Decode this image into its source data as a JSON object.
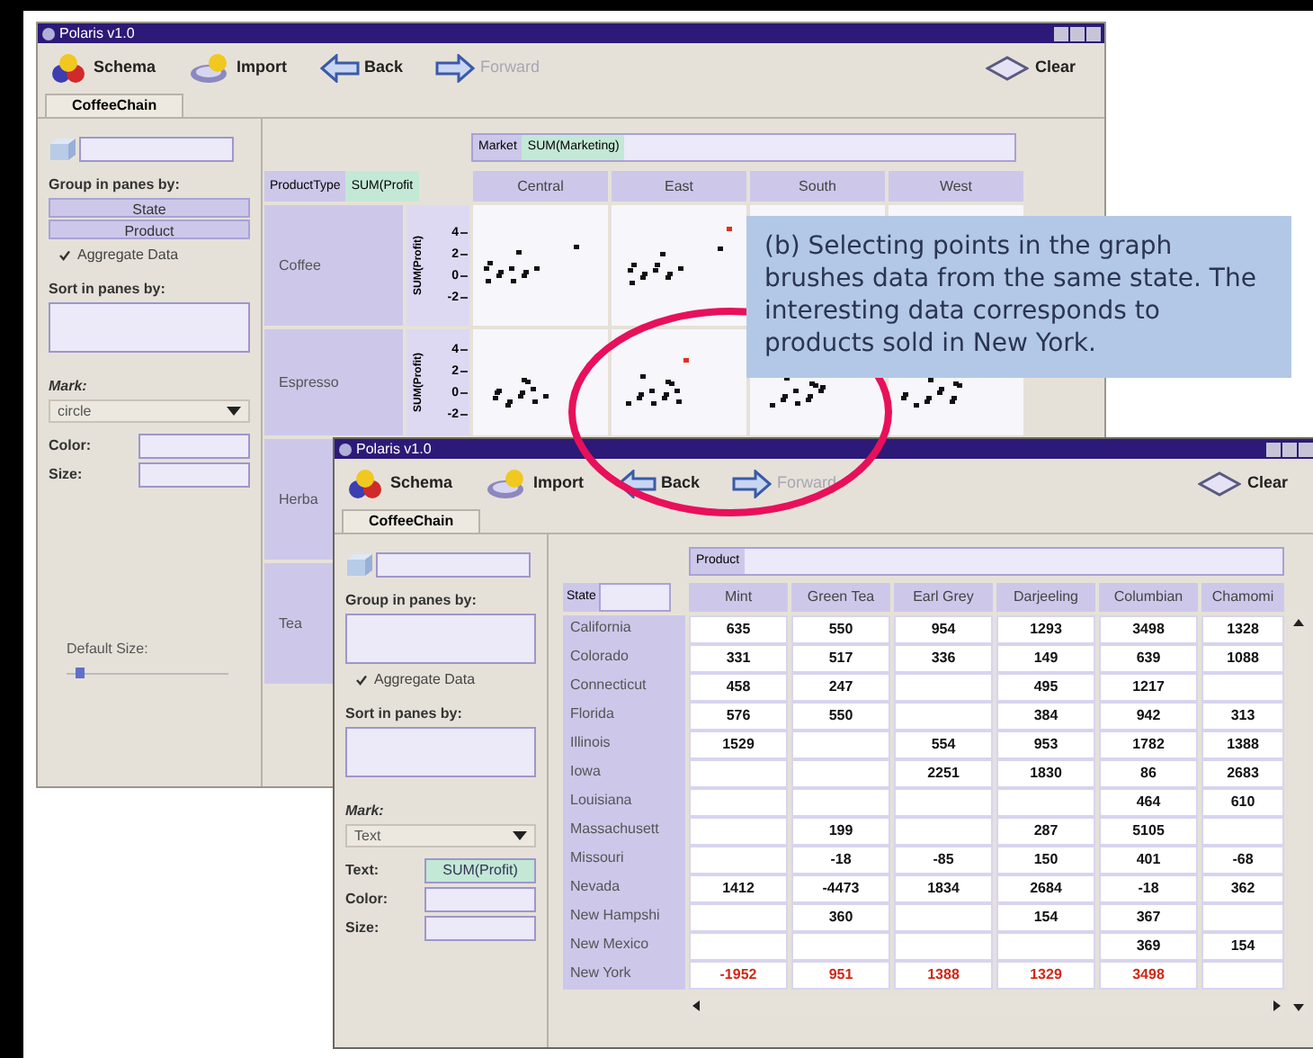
{
  "back_window": {
    "title": "Polaris v1.0",
    "toolbar": [
      {
        "kind": "schema",
        "label": "Schema",
        "disabled": false
      },
      {
        "kind": "import",
        "label": "Import",
        "disabled": false
      },
      {
        "kind": "back",
        "label": "Back",
        "disabled": false
      },
      {
        "kind": "forward",
        "label": "Forward",
        "disabled": true
      },
      {
        "kind": "clear",
        "label": "Clear",
        "disabled": false
      }
    ],
    "tabs": [
      {
        "label": "CoffeeChain",
        "selected": true
      }
    ],
    "left_panel": {
      "group_label": "Group in panes by:",
      "group_items": [
        "State",
        "Product"
      ],
      "aggregate": {
        "label": "Aggregate Data",
        "checked": true
      },
      "sort_label": "Sort in panes by:",
      "mark_label": "Mark:",
      "mark_value": "circle",
      "fields": [
        {
          "label": "Color:"
        },
        {
          "label": "Size:"
        }
      ],
      "default_size": {
        "label": "Default Size:",
        "level": 0.05
      }
    },
    "graph": {
      "column_shelf": {
        "label": "Market",
        "pill": "SUM(Marketing)"
      },
      "row_shelf": {
        "label": "ProductType",
        "pill": "SUM(Profit"
      },
      "columns": [
        "Central",
        "East",
        "South",
        "West"
      ],
      "rows": [
        {
          "label": "Coffee",
          "axis": {
            "title": "SUM(Profit)",
            "ticks": [
              "4",
              "2",
              "0",
              "-2"
            ]
          }
        },
        {
          "label": "Espresso",
          "axis": {
            "title": "SUM(Profit)",
            "ticks": [
              "4",
              "2",
              "0",
              "-2"
            ]
          }
        },
        {
          "label": "Herba"
        },
        {
          "label": "Tea"
        }
      ]
    }
  },
  "callout": {
    "text": "(b) Selecting points in the graph brushes data from the same state. The interesting data corresponds to products sold in New York."
  },
  "front_window": {
    "title": "Polaris v1.0",
    "toolbar": [
      {
        "kind": "schema",
        "label": "Schema",
        "disabled": false
      },
      {
        "kind": "import",
        "label": "Import",
        "disabled": false
      },
      {
        "kind": "back",
        "label": "Back",
        "disabled": false
      },
      {
        "kind": "forward",
        "label": "Forward",
        "disabled": true
      },
      {
        "kind": "clear",
        "label": "Clear",
        "disabled": false
      }
    ],
    "tabs": [
      {
        "label": "CoffeeChain",
        "selected": true
      }
    ],
    "left_panel": {
      "group_label": "Group in panes by:",
      "aggregate": {
        "label": "Aggregate Data",
        "checked": true
      },
      "sort_label": "Sort in panes by:",
      "mark_label": "Mark:",
      "mark_value": "Text",
      "fields": [
        {
          "label": "Text:",
          "value": "SUM(Profit)"
        },
        {
          "label": "Color:"
        },
        {
          "label": "Size:"
        }
      ]
    },
    "table": {
      "column_shelf": {
        "label": "Product"
      },
      "row_field": {
        "label": "State"
      },
      "columns": [
        "Mint",
        "Green Tea",
        "Earl Grey",
        "Darjeeling",
        "Columbian",
        "Chamomi"
      ],
      "rows": [
        {
          "label": "California",
          "highlighted": false,
          "cells": [
            "635",
            "550",
            "954",
            "1293",
            "3498",
            "1328"
          ]
        },
        {
          "label": "Colorado",
          "highlighted": false,
          "cells": [
            "331",
            "517",
            "336",
            "149",
            "639",
            "1088"
          ]
        },
        {
          "label": "Connecticut",
          "highlighted": false,
          "cells": [
            "458",
            "247",
            null,
            "495",
            "1217",
            null
          ]
        },
        {
          "label": "Florida",
          "highlighted": false,
          "cells": [
            "576",
            "550",
            null,
            "384",
            "942",
            "313"
          ]
        },
        {
          "label": "Illinois",
          "highlighted": false,
          "cells": [
            "1529",
            null,
            "554",
            "953",
            "1782",
            "1388"
          ]
        },
        {
          "label": "Iowa",
          "highlighted": false,
          "cells": [
            null,
            null,
            "2251",
            "1830",
            "86",
            "2683"
          ]
        },
        {
          "label": "Louisiana",
          "highlighted": false,
          "cells": [
            null,
            null,
            null,
            null,
            "464",
            "610"
          ]
        },
        {
          "label": "Massachusett",
          "highlighted": false,
          "cells": [
            null,
            "199",
            null,
            "287",
            "5105",
            null
          ]
        },
        {
          "label": "Missouri",
          "highlighted": false,
          "cells": [
            null,
            "-18",
            "-85",
            "150",
            "401",
            "-68"
          ]
        },
        {
          "label": "Nevada",
          "highlighted": false,
          "cells": [
            "1412",
            "-4473",
            "1834",
            "2684",
            "-18",
            "362"
          ]
        },
        {
          "label": "New Hampshi",
          "highlighted": false,
          "cells": [
            null,
            "360",
            null,
            "154",
            "367",
            null
          ]
        },
        {
          "label": "New Mexico",
          "highlighted": false,
          "cells": [
            null,
            null,
            null,
            null,
            "369",
            "154"
          ]
        },
        {
          "label": "New York",
          "highlighted": true,
          "cells": [
            "-1952",
            "951",
            "1388",
            "1329",
            "3498",
            null
          ]
        }
      ]
    }
  }
}
